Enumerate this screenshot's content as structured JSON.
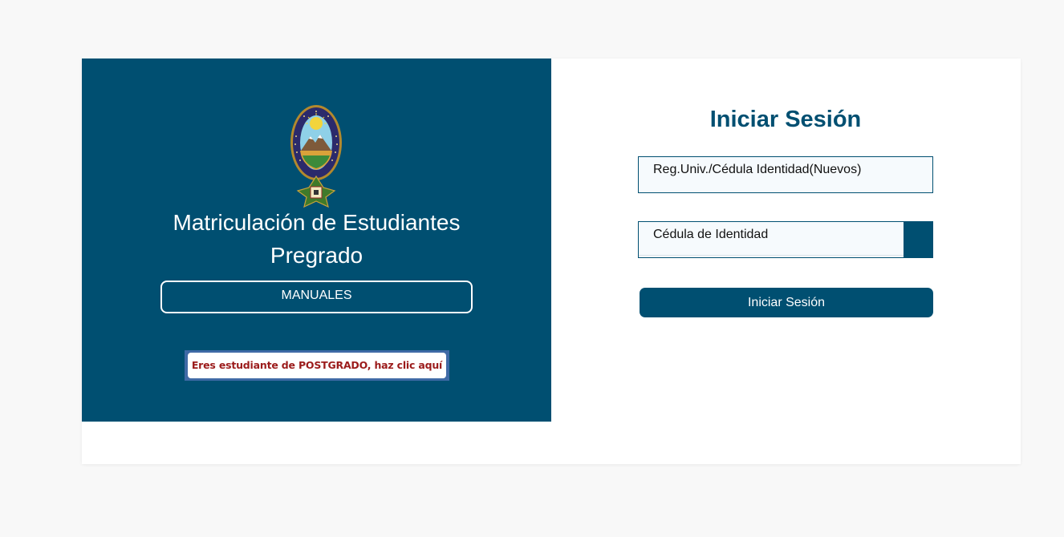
{
  "left_panel": {
    "title_line1": "Matriculación de Estudiantes",
    "title_line2": "Pregrado",
    "manuales_label": "MANUALES",
    "postgrado_label": "Eres estudiante de POSTGRADO, haz clic aquí",
    "seal_text": "UNIVERSITAS MAJOR PACENSIS DIVI ANDREÆ"
  },
  "login": {
    "title": "Iniciar Sesión",
    "username_placeholder": "Reg.Univ./Cédula Identidad(Nuevos)",
    "password_placeholder": "Cédula de Identidad",
    "toggle_icon": "eye-icon",
    "submit_label": "Iniciar Sesión"
  },
  "colors": {
    "primary": "#004f71",
    "page_background": "#f8f8f8",
    "postgrado_text": "#9b1b1b",
    "postgrado_border": "#3f6aa6"
  }
}
